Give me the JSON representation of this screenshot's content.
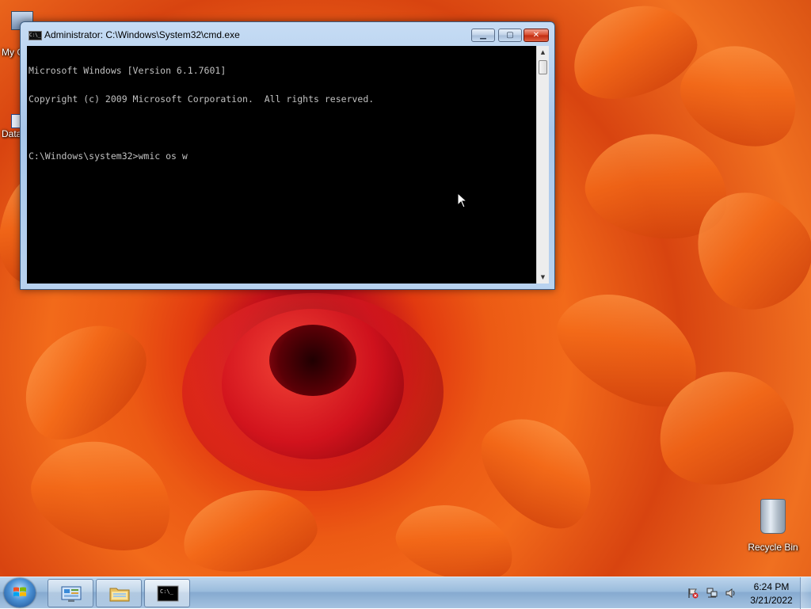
{
  "desktop": {
    "icons": [
      {
        "label": "My C",
        "icon": "computer-icon"
      },
      {
        "label": "Data",
        "icon": "shortcut-icon"
      },
      {
        "label": "Recycle Bin",
        "icon": "recycle-bin-icon"
      }
    ]
  },
  "cmd_window": {
    "title": "Administrator: C:\\Windows\\System32\\cmd.exe",
    "icon": "cmd-icon",
    "minimize_glyph": "▁",
    "maximize_glyph": "▢",
    "close_glyph": "✕",
    "console_lines": [
      "Microsoft Windows [Version 6.1.7601]",
      "Copyright (c) 2009 Microsoft Corporation.  All rights reserved.",
      "",
      "C:\\Windows\\system32>wmic os w"
    ],
    "scroll_up_glyph": "▲",
    "scroll_down_glyph": "▼"
  },
  "taskbar": {
    "start_icon": "windows-start-icon",
    "pinned": [
      {
        "name": "control-panel",
        "icon": "control-panel-icon"
      },
      {
        "name": "explorer",
        "icon": "folder-icon"
      },
      {
        "name": "cmd",
        "icon": "cmd-icon",
        "glyph": "C:\\_"
      }
    ],
    "tray": {
      "icons": [
        "action-center-flag-icon",
        "network-icon",
        "volume-icon"
      ],
      "time": "6:24 PM",
      "date": "3/21/2022"
    }
  },
  "colors": {
    "console_bg": "#000000",
    "console_fg": "#c0c0c0",
    "taskbar": "#9abcdc",
    "close_button": "#c8321a"
  }
}
